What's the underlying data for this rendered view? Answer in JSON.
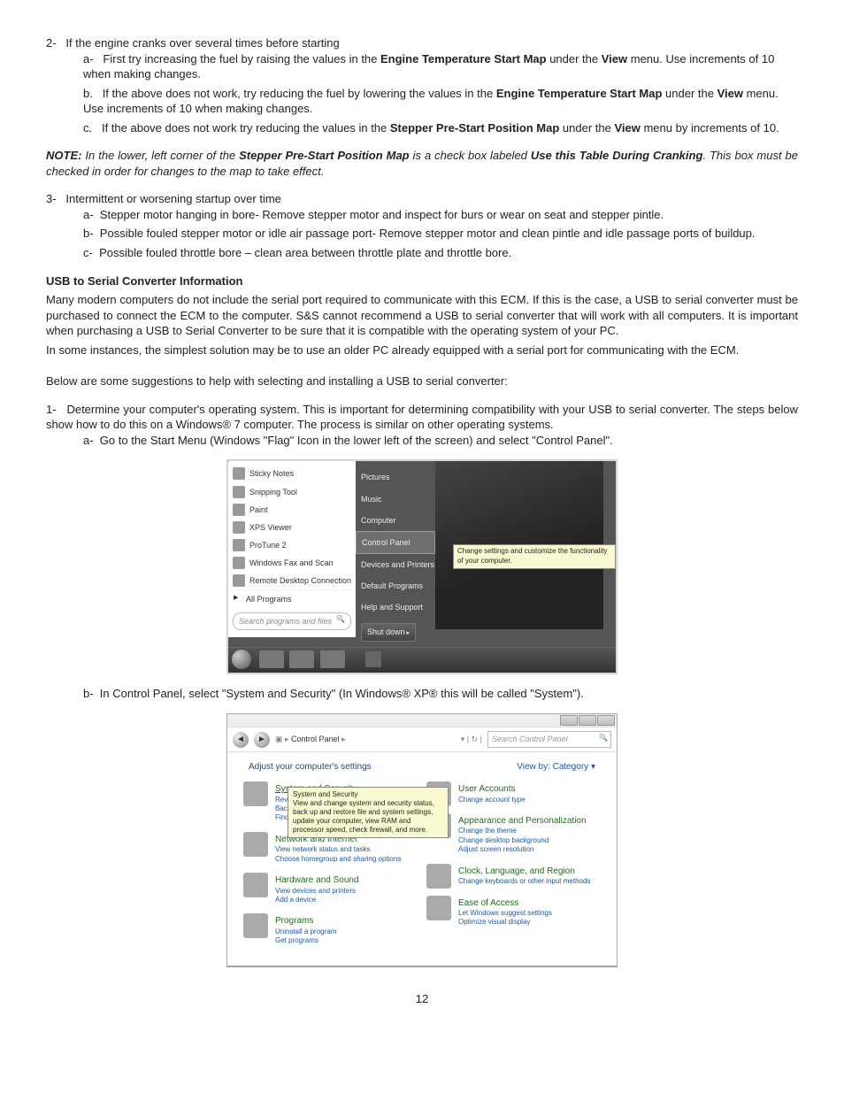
{
  "list2": {
    "num": "2-",
    "text": "If the engine cranks over several times before starting",
    "a": {
      "pre": "a-",
      "t1": "First try increasing the fuel by raising the values in the ",
      "b1": "Engine Temperature Start Map",
      "t2": " under the ",
      "b2": "View",
      "t3": " menu. Use increments of 10 when making changes."
    },
    "b": {
      "pre": "b.",
      "t1": "If the above does not work, try reducing the fuel by lowering the values in the ",
      "b1": "Engine Temperature Start Map",
      "t2": " under the ",
      "b2": "View",
      "t3": " menu. Use increments of 10 when making changes."
    },
    "c": {
      "pre": "c.",
      "t1": "If the above does not work try reducing the values in the ",
      "b1": "Stepper Pre-Start Position Map",
      "t2": " under the ",
      "b2": "View",
      "t3": " menu by increments of 10."
    }
  },
  "note": {
    "label": "NOTE:",
    "t1": " In the lower, left corner of the ",
    "b1": "Stepper Pre-Start Position Map",
    "t2": " is a check box labeled ",
    "b2": "Use this Table During Cranking",
    "t3": ".  This box must be checked in order for changes to the map to take effect."
  },
  "list3": {
    "num": "3-",
    "text": "Intermittent or worsening startup over time",
    "a": {
      "pre": "a-",
      "text": "Stepper motor hanging in bore- Remove stepper motor and inspect for burs or wear on seat and stepper pintle."
    },
    "b": {
      "pre": "b-",
      "text": "Possible fouled stepper motor or idle air passage port- Remove stepper motor and clean pintle and idle passage ports of buildup."
    },
    "c": {
      "pre": "c-",
      "text": "Possible fouled throttle bore – clean area between throttle plate and throttle bore."
    }
  },
  "usb": {
    "heading": "USB to Serial Converter Information",
    "p1": "Many modern computers do not include the serial port required to communicate with this ECM.  If this is the case, a USB to serial converter must be purchased to connect the ECM to the computer. S&S cannot recommend a USB to serial converter that will work with all computers.  It is important when purchasing a USB to Serial Converter to be sure that it is compatible with the operating system of your PC.",
    "p2": "In some instances, the simplest solution may be to use an older PC already equipped with a serial port for communicating with the ECM.",
    "p3": "Below are some suggestions to help with selecting and installing a USB to serial converter:"
  },
  "list1": {
    "num": "1-",
    "text": "Determine your computer's operating system.  This is important for determining compatibility with your USB to serial converter. The steps below show how to do this on a Windows® 7 computer.  The process is similar on other operating systems.",
    "a": {
      "pre": "a-",
      "text": "Go to the Start Menu (Windows \"Flag\" Icon in the lower left of the screen) and select \"Control Panel\"."
    },
    "b": {
      "pre": "b-",
      "text": "In Control Panel, select \"System and Security\" (In Windows® XP® this will be called \"System\")."
    }
  },
  "start_menu": {
    "apps": [
      "Sticky Notes",
      "Snipping Tool",
      "Paint",
      "XPS Viewer",
      "ProTune 2",
      "Windows Fax and Scan",
      "Remote Desktop Connection"
    ],
    "all_programs": "All Programs",
    "search_placeholder": "Search programs and files",
    "right_items": [
      "Pictures",
      "Music",
      "Computer",
      "Control Panel",
      "Devices and Printers",
      "Default Programs",
      "Help and Support"
    ],
    "shutdown": "Shut down",
    "tooltip": "Change settings and customize the functionality of your computer."
  },
  "control_panel": {
    "breadcrumb": "Control Panel",
    "search_placeholder": "Search Control Panel",
    "adjust": "Adjust your computer's settings",
    "view_by": "View by:   Category ▾",
    "tooltip_title": "System and Security",
    "tooltip_body": "View and change system and security status, back up and restore file and system settings, update your computer, view RAM and processor speed, check firewall, and more.",
    "left": [
      {
        "title": "System and Security",
        "und": true,
        "subs": [
          "Review your computer's status",
          "Back up your computer",
          "Find and fix problems"
        ]
      },
      {
        "title": "Network and Internet",
        "subs": [
          "View network status and tasks",
          "Choose homegroup and sharing options"
        ]
      },
      {
        "title": "Hardware and Sound",
        "subs": [
          "View devices and printers",
          "Add a device"
        ]
      },
      {
        "title": "Programs",
        "subs": [
          "Uninstall a program",
          "Get programs"
        ]
      }
    ],
    "right": [
      {
        "title": "User Accounts",
        "subs": [
          "Change account type"
        ]
      },
      {
        "title": "Appearance and Personalization",
        "subs": [
          "Change the theme",
          "Change desktop background",
          "Adjust screen resolution"
        ]
      },
      {
        "title": "Clock, Language, and Region",
        "subs": [
          "Change keyboards or other input methods"
        ]
      },
      {
        "title": "Ease of Access",
        "subs": [
          "Let Windows suggest settings",
          "Optimize visual display"
        ]
      }
    ]
  },
  "page_number": "12"
}
